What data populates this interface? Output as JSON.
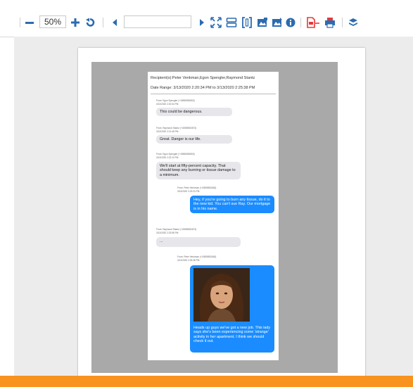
{
  "toolbar": {
    "zoom_value": "50%",
    "page_value": "",
    "icons": [
      "zoom-out-icon",
      "zoom-in-icon",
      "rotate-icon",
      "prev-page-icon",
      "next-page-icon",
      "fit-icon",
      "fit-page-icon",
      "fit-width-icon",
      "image-export-icon",
      "image-export-alt-icon",
      "info-icon",
      "pdf-icon",
      "print-icon",
      "layers-icon"
    ]
  },
  "document": {
    "recipients": "Recipient(s):Peter Venkman,Egon Spengler,Raymond Stantz",
    "date_range": "Date Range: 3/13/2020 2:20:34 PM to 3/13/2020 2:25:38 PM",
    "messages": [
      {
        "from": "From: Egon Spengler (+15555552653)",
        "time": "3/13/2020 2:20:34 PM",
        "text": "This could be dangerous.",
        "direction": "incoming"
      },
      {
        "from": "From: Raymond Stantz (+15555552673)",
        "time": "3/13/2020 2:21:45 PM",
        "text": "Great. Danger is our life.",
        "direction": "incoming"
      },
      {
        "from": "From: Egon Spengler (+15555552653)",
        "time": "3/13/2020 2:22:10 PM",
        "text": "We'll start at fifty-percent capacity. That should keep any burning or tissue damage to a minimum.",
        "direction": "incoming"
      },
      {
        "from": "From: Peter Venkman (+15555552663)",
        "time": "3/13/2020 2:23:23 PM",
        "text": "Hey, if you're going to burn any tissue, do it to the new kid. You can't sue Ray. Our mortgage is in his name.",
        "direction": "outgoing"
      },
      {
        "from": "From: Raymond Stantz (+15555552673)",
        "time": "3/13/2020 2:23:58 PM",
        "text": "...",
        "direction": "incoming"
      },
      {
        "from": "From: Peter Venkman (+15555552663)",
        "time": "3/13/2020 2:25:38 PM",
        "text": "Heads up guys we've got a new job. This lady says she's been experiencing some 'strange' activity in her apartment. I think we should check it out.",
        "direction": "outgoing",
        "has_image": true
      }
    ]
  },
  "colors": {
    "accent": "#1a8cff",
    "toolbar_icon": "#2b6cb0",
    "pdf_icon": "#e53935",
    "bottom_bar": "#f7931e"
  }
}
